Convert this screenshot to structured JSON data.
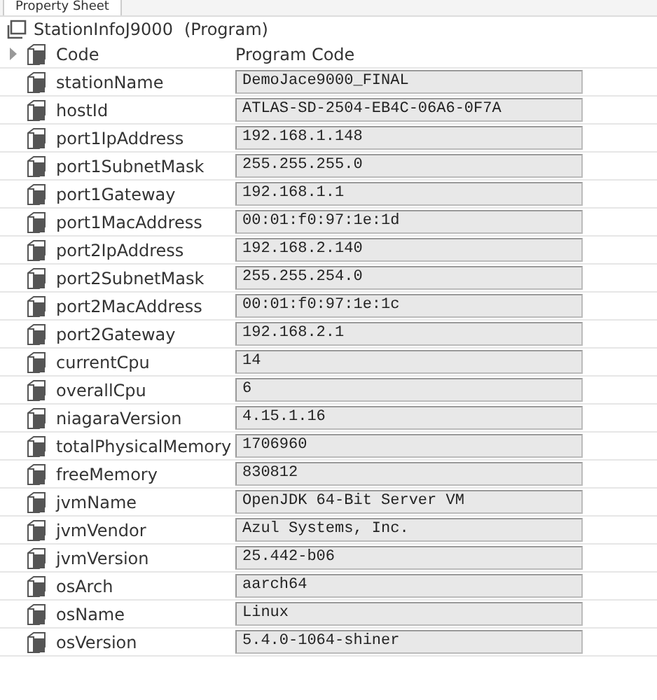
{
  "tab": {
    "label": "Property Sheet"
  },
  "header": {
    "title": "StationInfoJ9000",
    "type": "(Program)"
  },
  "rows": [
    {
      "name": "Code",
      "value": "Program Code",
      "kind": "folder",
      "expanded": false
    },
    {
      "name": "stationName",
      "value": "DemoJace9000_FINAL",
      "kind": "field"
    },
    {
      "name": "hostId",
      "value": "ATLAS-SD-2504-EB4C-06A6-0F7A",
      "kind": "field"
    },
    {
      "name": "port1IpAddress",
      "value": "192.168.1.148",
      "kind": "field"
    },
    {
      "name": "port1SubnetMask",
      "value": "255.255.255.0",
      "kind": "field"
    },
    {
      "name": "port1Gateway",
      "value": "192.168.1.1",
      "kind": "field"
    },
    {
      "name": "port1MacAddress",
      "value": "00:01:f0:97:1e:1d",
      "kind": "field"
    },
    {
      "name": "port2IpAddress",
      "value": "192.168.2.140",
      "kind": "field"
    },
    {
      "name": "port2SubnetMask",
      "value": "255.255.254.0",
      "kind": "field"
    },
    {
      "name": "port2MacAddress",
      "value": "00:01:f0:97:1e:1c",
      "kind": "field"
    },
    {
      "name": "port2Gateway",
      "value": "192.168.2.1",
      "kind": "field"
    },
    {
      "name": "currentCpu",
      "value": "14",
      "kind": "field"
    },
    {
      "name": "overallCpu",
      "value": "6",
      "kind": "field"
    },
    {
      "name": "niagaraVersion",
      "value": "4.15.1.16",
      "kind": "field"
    },
    {
      "name": "totalPhysicalMemory",
      "value": "1706960",
      "kind": "field"
    },
    {
      "name": "freeMemory",
      "value": "830812",
      "kind": "field"
    },
    {
      "name": "jvmName",
      "value": "OpenJDK 64-Bit Server VM",
      "kind": "field"
    },
    {
      "name": "jvmVendor",
      "value": "Azul Systems, Inc.",
      "kind": "field"
    },
    {
      "name": "jvmVersion",
      "value": "25.442-b06",
      "kind": "field"
    },
    {
      "name": "osArch",
      "value": "aarch64",
      "kind": "field"
    },
    {
      "name": "osName",
      "value": "Linux",
      "kind": "field"
    },
    {
      "name": "osVersion",
      "value": "5.4.0-1064-shiner",
      "kind": "field"
    }
  ]
}
